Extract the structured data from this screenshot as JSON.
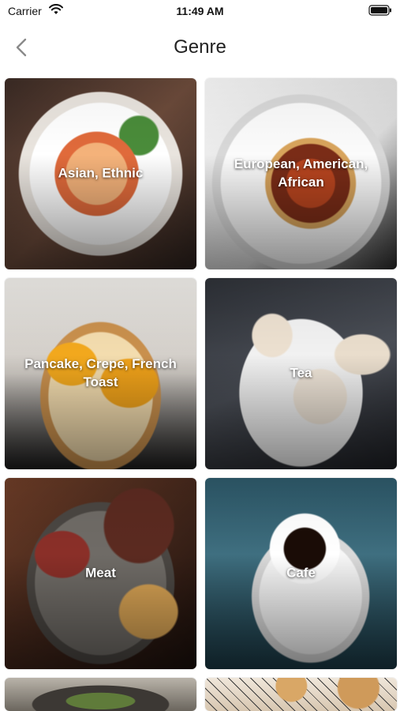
{
  "status_bar": {
    "carrier": "Carrier",
    "time": "11:49 AM",
    "icons": [
      "wifi-icon",
      "battery-icon"
    ]
  },
  "nav": {
    "title": "Genre",
    "back_icon": "chevron-left-icon"
  },
  "genres": [
    {
      "label": "Asian, Ethnic"
    },
    {
      "label": "European, American, African"
    },
    {
      "label": "Pancake, Crepe, French Toast"
    },
    {
      "label": "Tea"
    },
    {
      "label": "Meat"
    },
    {
      "label": "Cafe"
    },
    {
      "label": ""
    },
    {
      "label": ""
    }
  ],
  "colors": {
    "background": "#ffffff",
    "title_text": "#222222",
    "tile_label": "#ffffff"
  }
}
